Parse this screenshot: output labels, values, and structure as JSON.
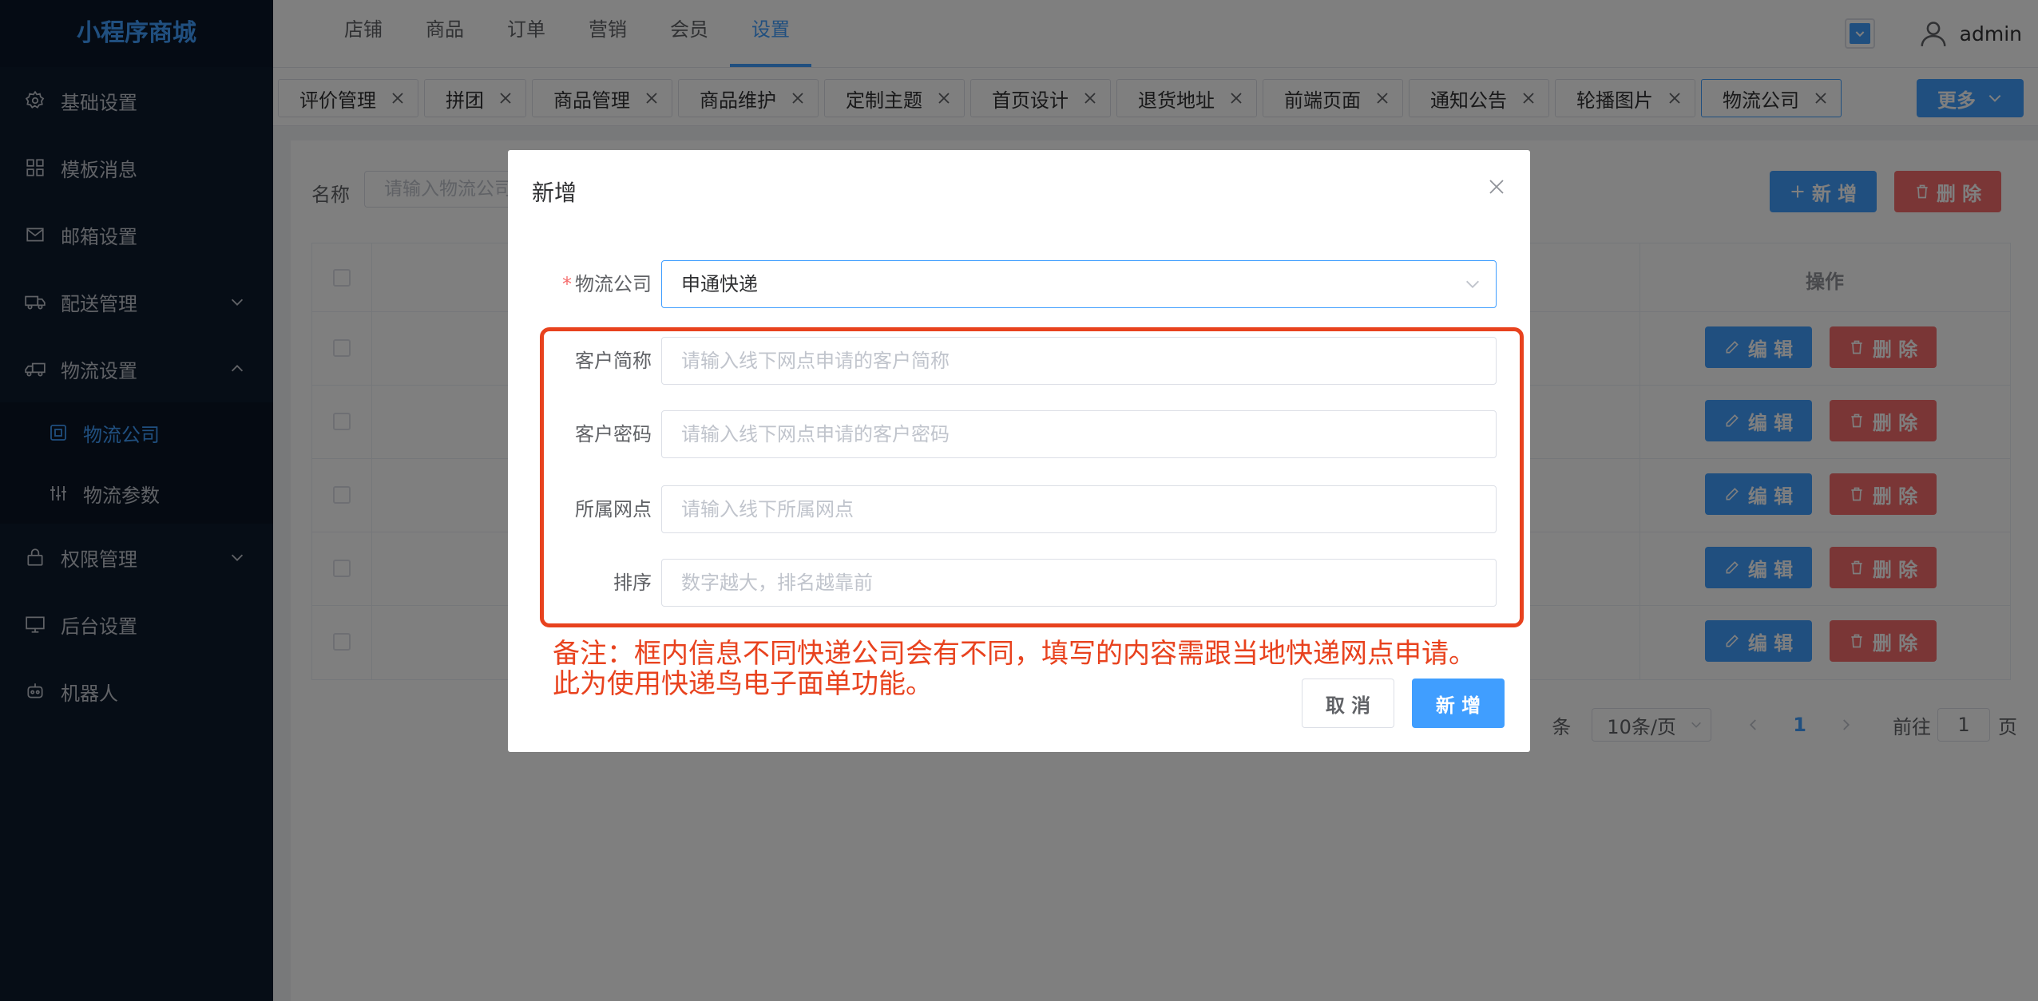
{
  "app_title": "小程序商城",
  "sidebar": {
    "items": [
      {
        "label": "基础设置",
        "icon": "gear-icon"
      },
      {
        "label": "模板消息",
        "icon": "grid-icon"
      },
      {
        "label": "邮箱设置",
        "icon": "mail-icon"
      },
      {
        "label": "配送管理",
        "icon": "truck-icon"
      },
      {
        "label": "物流设置",
        "icon": "truck-icon"
      },
      {
        "label": "物流公司",
        "icon": "building-icon"
      },
      {
        "label": "物流参数",
        "icon": "sliders-icon"
      },
      {
        "label": "权限管理",
        "icon": "lock-icon"
      },
      {
        "label": "后台设置",
        "icon": "monitor-icon"
      },
      {
        "label": "机器人",
        "icon": "robot-icon"
      }
    ]
  },
  "topnav": {
    "tabs": [
      "店铺",
      "商品",
      "订单",
      "营销",
      "会员",
      "设置"
    ],
    "active": "设置"
  },
  "user": {
    "name": "admin"
  },
  "tags": [
    "评价管理",
    "拼团",
    "商品管理",
    "商品维护",
    "定制主题",
    "首页设计",
    "退货地址",
    "前端页面",
    "通知公告",
    "轮播图片",
    "物流公司"
  ],
  "more_label": "更多",
  "content": {
    "search_label": "名称",
    "search_placeholder": "请输入物流公司",
    "add_label": "新 增",
    "delete_label": "删 除",
    "op_header": "操作",
    "edit_label": "编 辑",
    "row_delete_label": "删 除",
    "pager": {
      "total_suffix": "条",
      "page_size": "10条/页",
      "current_page": "1",
      "goto_label": "前往",
      "goto_value": "1",
      "page_unit": "页"
    }
  },
  "dialog": {
    "title": "新增",
    "fields": [
      {
        "label": "物流公司",
        "required": true,
        "value": "申通快递"
      },
      {
        "label": "客户简称",
        "placeholder": "请输入线下网点申请的客户简称"
      },
      {
        "label": "客户密码",
        "placeholder": "请输入线下网点申请的客户密码"
      },
      {
        "label": "所属网点",
        "placeholder": "请输入线下所属网点"
      },
      {
        "label": "排序",
        "placeholder": "数字越大，排名越靠前"
      }
    ],
    "note_line1": "备注：框内信息不同快递公司会有不同，填写的内容需跟当地快递网点申请。",
    "note_line2": "此为使用快递鸟电子面单功能。",
    "cancel_label": "取 消",
    "ok_label": "新 增"
  },
  "colors": {
    "primary": "#409eff",
    "danger": "#f56c6c",
    "sidebar_bg": "#0d1a2d",
    "annotation": "#e8421e"
  }
}
